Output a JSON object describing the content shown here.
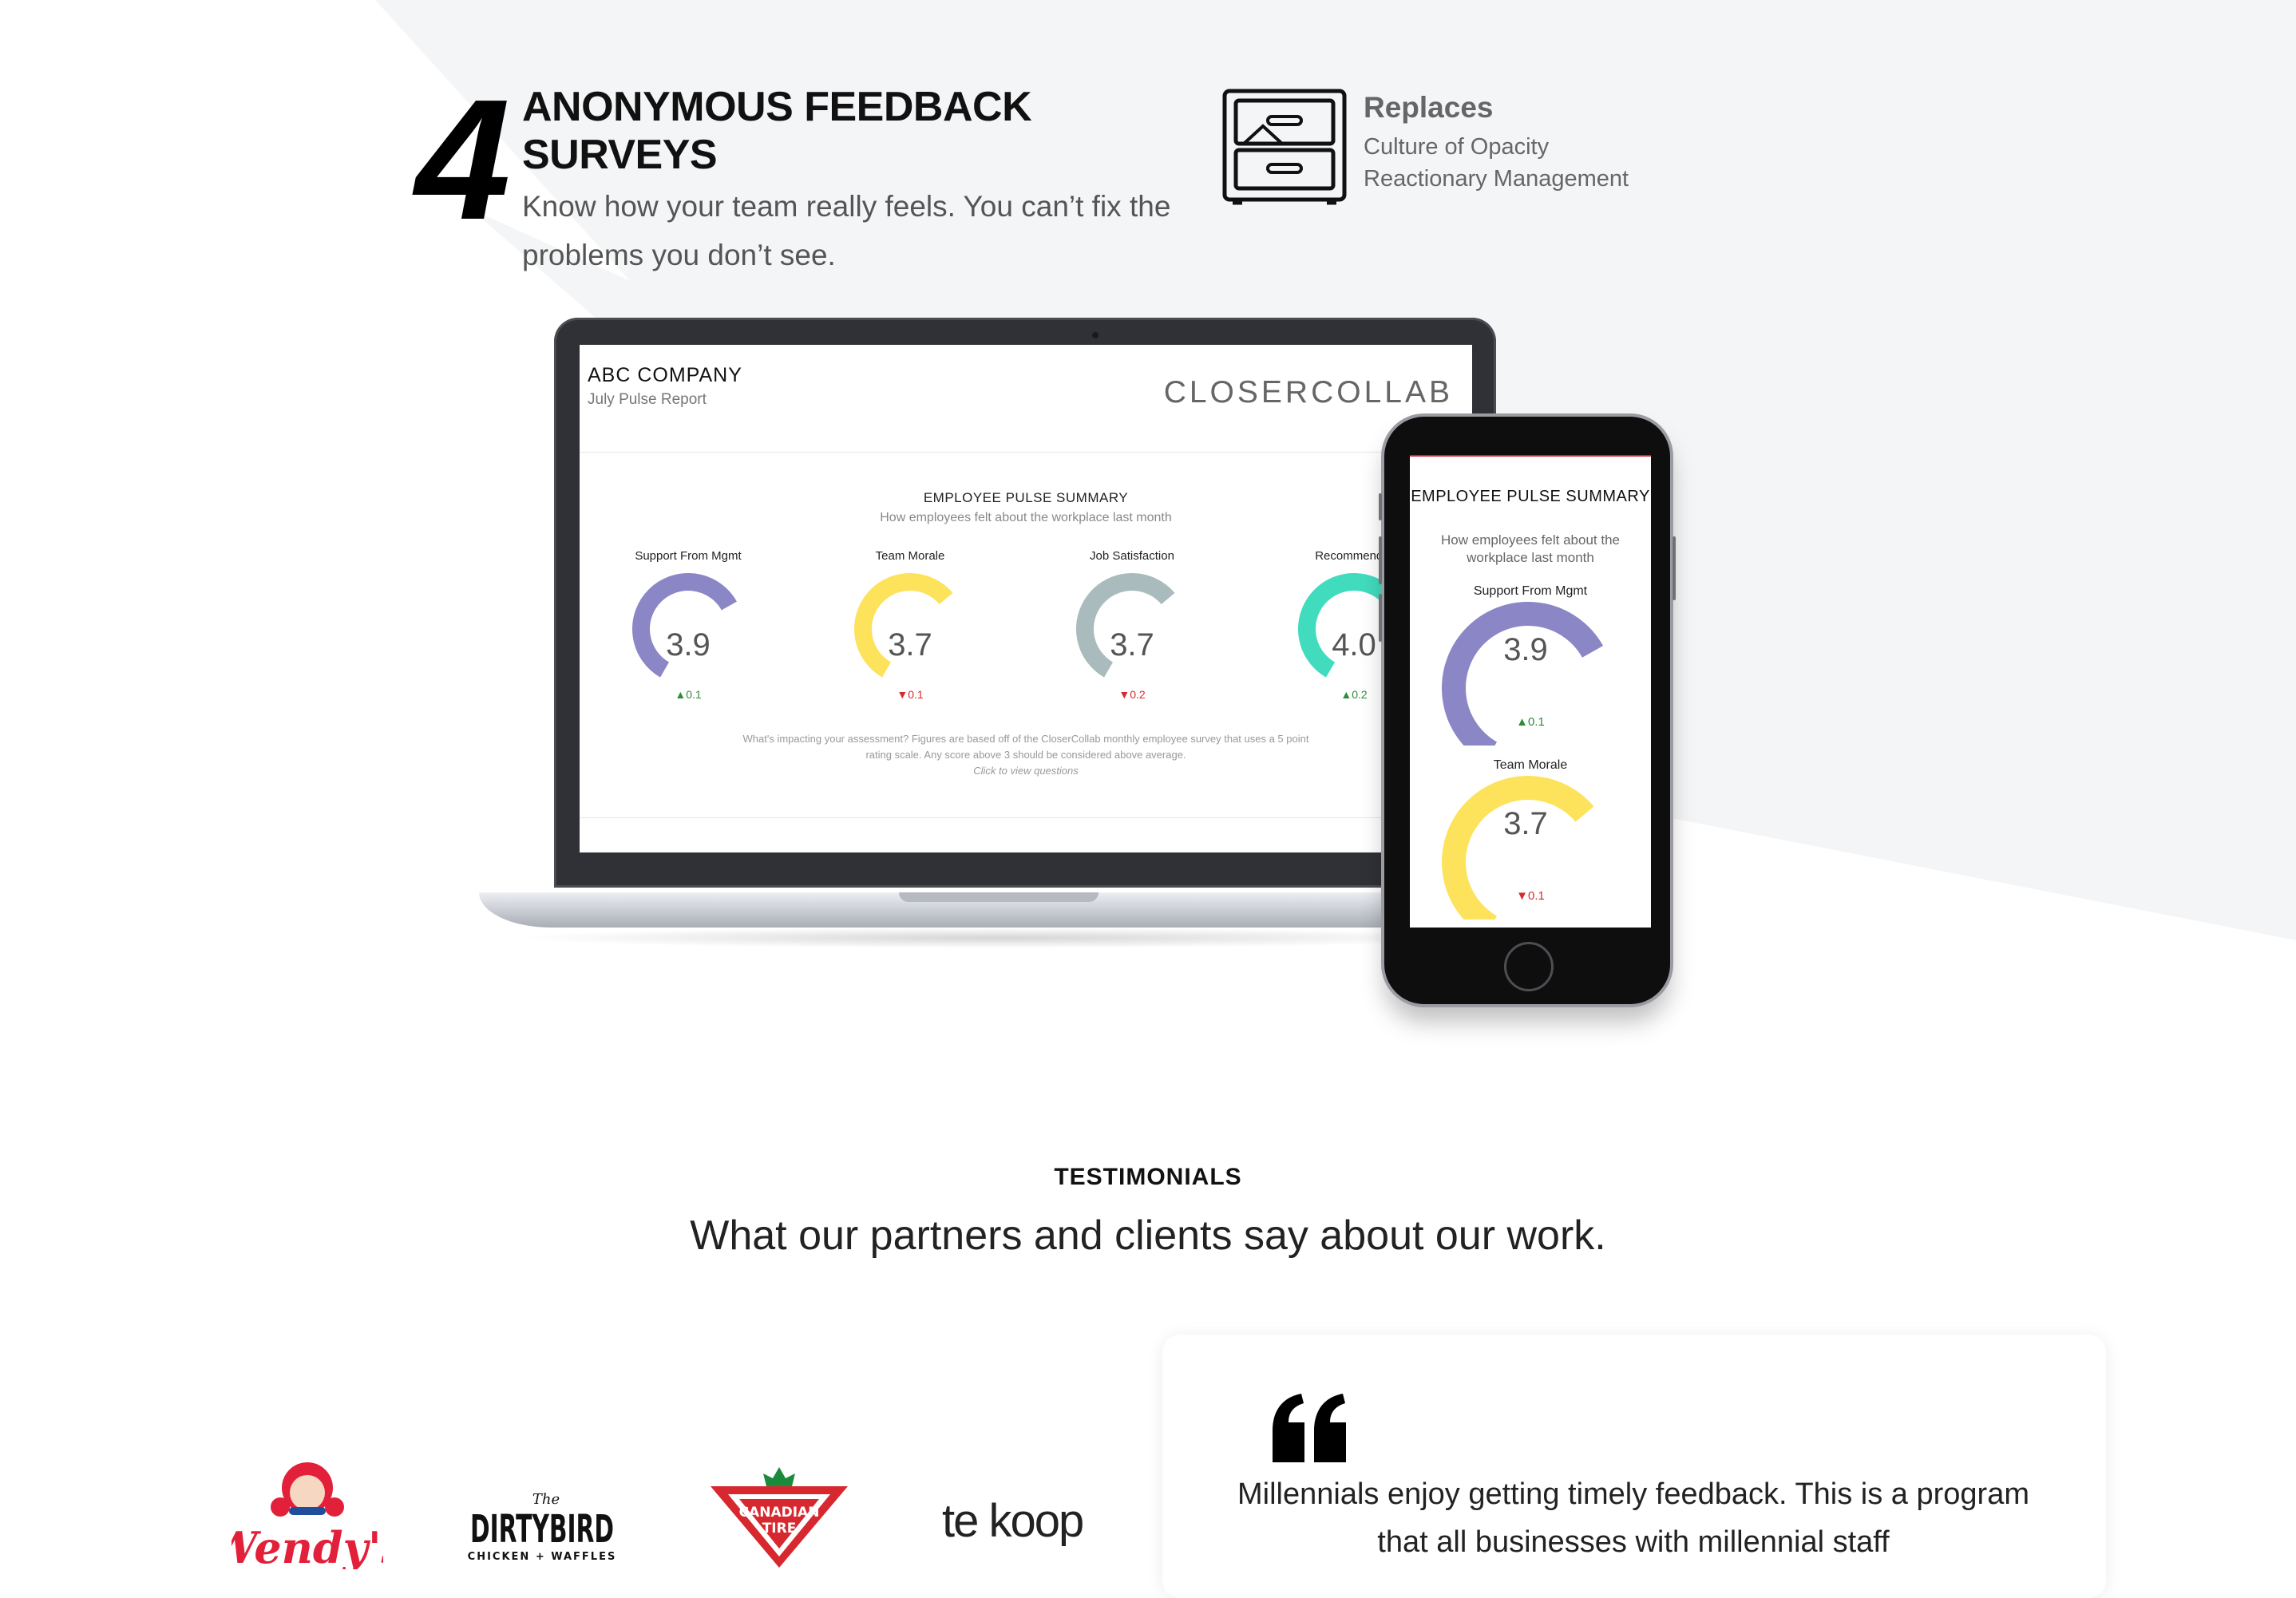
{
  "feature": {
    "number": "4",
    "title_line1": "ANONYMOUS FEEDBACK",
    "title_line2": "SURVEYS",
    "description": "Know how your team really feels. You can’t fix the problems you don’t see.",
    "replaces": {
      "title": "Replaces",
      "items": [
        "Culture of Opacity",
        "Reactionary Management"
      ],
      "icon": "file-cabinet-icon"
    }
  },
  "laptop_report": {
    "company": "ABC COMPANY",
    "report": "July Pulse Report",
    "brand": "CLOSERCOLLAB",
    "summary_title": "EMPLOYEE PULSE SUMMARY",
    "summary_subtitle": "How employees felt about the workplace last month",
    "gauges": [
      {
        "label": "Support From Mgmt",
        "value": "3.9",
        "score": 3.9,
        "delta": "0.1",
        "direction": "up",
        "color": "#8b86c6"
      },
      {
        "label": "Team Morale",
        "value": "3.7",
        "score": 3.7,
        "delta": "0.1",
        "direction": "down",
        "color": "#fde35c"
      },
      {
        "label": "Job Satisfaction",
        "value": "3.7",
        "score": 3.7,
        "delta": "0.2",
        "direction": "down",
        "color": "#a9bbbd"
      },
      {
        "label": "Recommend a",
        "value": "4.0",
        "score": 4.0,
        "delta": "0.2",
        "direction": "up",
        "color": "#41dcbe"
      }
    ],
    "footnote": "What's impacting your assessment? Figures are based off of the CloserCollab monthly employee survey that uses a 5 point rating scale. Any score above 3 should be considered above average.",
    "footnote_link": "Click to view questions"
  },
  "phone_report": {
    "title": "EMPLOYEE PULSE SUMMARY",
    "subtitle": "How employees felt about the workplace last month",
    "gauges": [
      {
        "label": "Support From Mgmt",
        "value": "3.9",
        "score": 3.9,
        "delta": "0.1",
        "direction": "up",
        "color": "#8b86c6"
      },
      {
        "label": "Team Morale",
        "value": "3.7",
        "score": 3.7,
        "delta": "0.1",
        "direction": "down",
        "color": "#fde35c"
      }
    ]
  },
  "testimonials": {
    "kicker": "TESTIMONIALS",
    "heading": "What our partners and clients say about our work.",
    "logos": [
      {
        "name": "Wendy's",
        "text": "Wendy's"
      },
      {
        "name": "The Dirty Bird",
        "text_top": "The",
        "text_main": "DIRTYBIRD",
        "text_sub": "CHICKEN + WAFFLES"
      },
      {
        "name": "Canadian Tire",
        "text_line1": "CANADIAN",
        "text_line2": "TIRE"
      },
      {
        "name": "te koop",
        "text": "te koop"
      }
    ],
    "quote": "Millennials enjoy getting timely feedback. This is a program that all businesses with millennial staff"
  },
  "colors": {
    "gauge_track": "#dedede",
    "up": "#2e8b3a",
    "down": "#d62b2b",
    "accent_red": "#d61f2f"
  }
}
